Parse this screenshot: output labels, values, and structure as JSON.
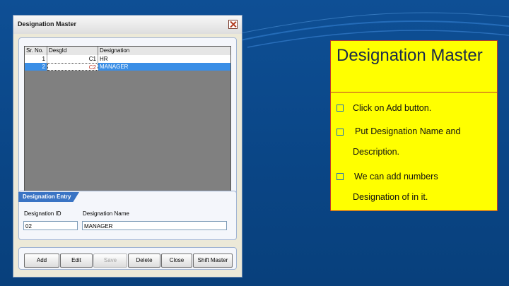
{
  "window": {
    "title": "Designation Master",
    "grid": {
      "columns": [
        "Sr. No.",
        "DesgId",
        "Designation"
      ],
      "rows": [
        {
          "sr_no": "1",
          "desg_id": "C1",
          "designation": "HR"
        },
        {
          "sr_no": "2",
          "desg_id": "C2",
          "designation": "MANAGER"
        }
      ]
    },
    "entry": {
      "section_label": "Designation Entry",
      "id_label": "Designation ID",
      "id_value": "02",
      "name_label": "Designation Name",
      "name_value": "MANAGER"
    },
    "buttons": {
      "add": "Add",
      "edit": "Edit",
      "save": "Save",
      "delete": "Delete",
      "close": "Close",
      "shift_master": "Shift Master"
    }
  },
  "note": {
    "title": "Designation Master",
    "bullets": [
      "Click on Add button.",
      "Put Designation Name and",
      "Description.",
      "We can add numbers",
      "Designation of in it."
    ]
  },
  "colors": {
    "slide_bg": "#0b4a8c",
    "selected_row": "#3a8ee6",
    "note_bg": "#ffff00",
    "note_border": "#c0392b"
  }
}
